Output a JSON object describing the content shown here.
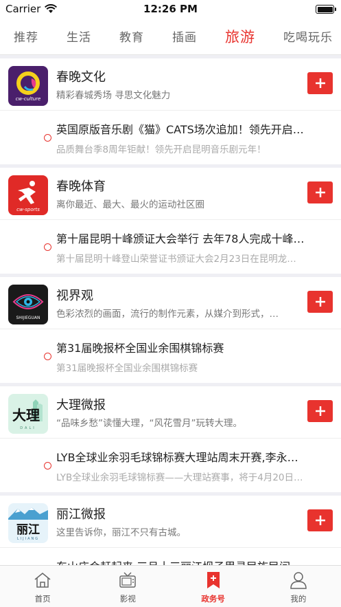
{
  "status": {
    "carrier": "Carrier",
    "time": "12:26 PM"
  },
  "tabs": [
    {
      "label": "推荐"
    },
    {
      "label": "生活"
    },
    {
      "label": "教育"
    },
    {
      "label": "插画"
    },
    {
      "label": "旅游",
      "active": true
    },
    {
      "label": "吃喝玩乐"
    }
  ],
  "cards": [
    {
      "name": "春晚文化",
      "desc": "精彩春城秀场  寻思文化魅力",
      "logo_text": "cw-culture",
      "news_title": "英国原版音乐剧《猫》CATS场次追加！领先开启…",
      "news_sub": "品质舞台季8周年钜献！领先开启昆明音乐剧元年！"
    },
    {
      "name": "春晚体育",
      "desc": "离你最近、最大、最火的运动社区圈",
      "logo_text": "cw-sports",
      "news_title": "第十届昆明十峰颁证大会举行 去年78人完成十峰…",
      "news_sub": "第十届昆明十峰登山荣誉证书颁证大会2月23日在昆明龙…"
    },
    {
      "name": "视界观",
      "desc": "色彩浓烈的画面，流行的制作元素，从媒介到形式，…",
      "logo_text": "SHIJIEGUAN",
      "news_title": "第31届晚报杯全国业余围棋锦标赛",
      "news_sub": "第31届晚报杯全国业余围棋锦标赛"
    },
    {
      "name": "大理微报",
      "desc": "“品味乡愁”读懂大理，“风花雪月”玩转大理。",
      "logo_text": "大理",
      "logo_sub": "DALI",
      "news_title": "LYB全球业余羽毛球锦标赛大理站周末开赛,李永…",
      "news_sub": "LYB全球业余羽毛球锦标赛——大理站赛事，将于4月20日…"
    },
    {
      "name": "丽江微报",
      "desc": "这里告诉你，丽江不只有古城。",
      "logo_text": "丽江",
      "logo_sub": "LIJIANG",
      "news_title": "东山庙会赶起来 三月十三丽江坝子里寻民族民间…",
      "news_sub": ""
    }
  ],
  "bottom_nav": [
    {
      "label": "首页",
      "icon": "home-icon"
    },
    {
      "label": "影视",
      "icon": "tv-icon"
    },
    {
      "label": "政务号",
      "icon": "bookmark-plus-icon",
      "active": true
    },
    {
      "label": "我的",
      "icon": "user-icon"
    }
  ],
  "colors": {
    "accent": "#e8332e"
  }
}
